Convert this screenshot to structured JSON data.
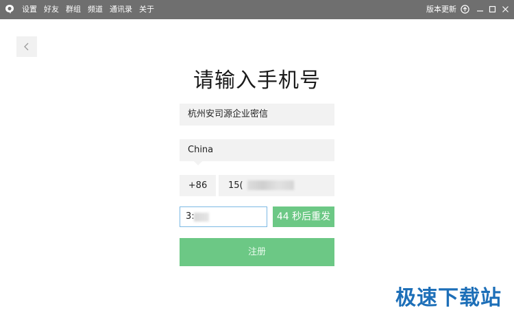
{
  "titlebar": {
    "menu": [
      "设置",
      "好友",
      "群组",
      "频道",
      "通讯录",
      "关于"
    ],
    "update_label": "版本更新"
  },
  "form": {
    "title": "请输入手机号",
    "company": "杭州安司源企业密信",
    "country": "China",
    "country_code": "+86",
    "phone_prefix": "15(",
    "verify_code_prefix": "3:",
    "resend_label": "44 秒后重发",
    "submit_label": "注册"
  },
  "watermark": {
    "text": "极速下载站"
  },
  "colors": {
    "titlebar_bg": "#6f6f6f",
    "accent_green": "#6cc885",
    "focus_border": "#7ab8e3",
    "field_bg": "#f2f2f2"
  }
}
